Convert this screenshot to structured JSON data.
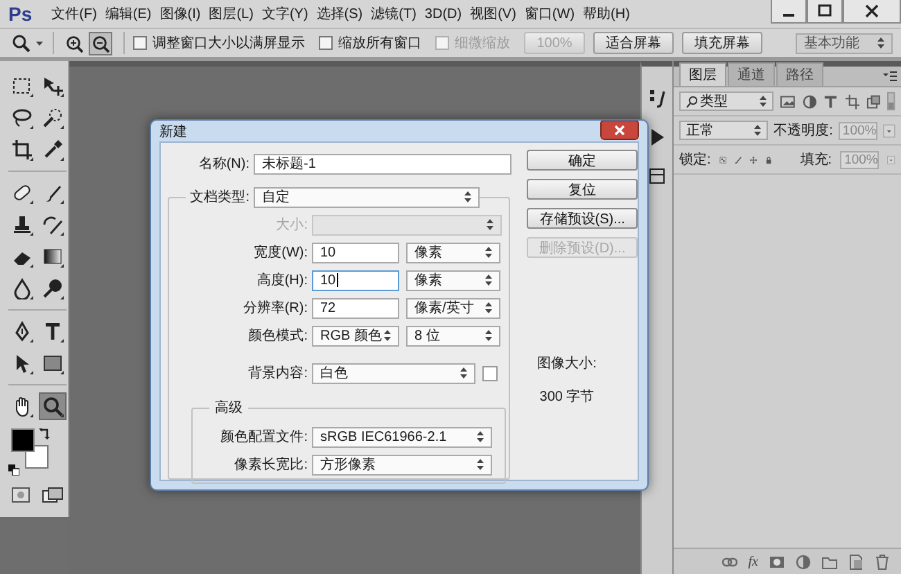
{
  "app": {
    "logo": "Ps",
    "menu": [
      "文件(F)",
      "编辑(E)",
      "图像(I)",
      "图层(L)",
      "文字(Y)",
      "选择(S)",
      "滤镜(T)",
      "3D(D)",
      "视图(V)",
      "窗口(W)",
      "帮助(H)"
    ]
  },
  "options_bar": {
    "zoom_modes": [
      {
        "kind": "zoom-in",
        "selected": false
      },
      {
        "kind": "zoom-out",
        "selected": true
      }
    ],
    "checkboxes": [
      {
        "label": "调整窗口大小以满屏显示",
        "checked": false,
        "disabled": false
      },
      {
        "label": "缩放所有窗口",
        "checked": false,
        "disabled": false
      },
      {
        "label": "细微缩放",
        "checked": false,
        "disabled": true
      }
    ],
    "buttons": [
      {
        "label": "100%",
        "disabled": true
      },
      {
        "label": "适合屏幕",
        "disabled": false
      },
      {
        "label": "填充屏幕",
        "disabled": false
      }
    ],
    "workspace": "基本功能"
  },
  "toolbox": {
    "tools": [
      {
        "kind": "marquee",
        "selected": false
      },
      {
        "kind": "move",
        "selected": false
      },
      {
        "kind": "lasso",
        "selected": false
      },
      {
        "kind": "quick-select",
        "selected": false
      },
      {
        "kind": "crop",
        "selected": false
      },
      {
        "kind": "eyedropper",
        "selected": false
      },
      {
        "kind": "healing",
        "selected": false
      },
      {
        "kind": "brush",
        "selected": false
      },
      {
        "kind": "stamp",
        "selected": false
      },
      {
        "kind": "history-brush",
        "selected": false
      },
      {
        "kind": "eraser",
        "selected": false
      },
      {
        "kind": "gradient",
        "selected": false
      },
      {
        "kind": "blur",
        "selected": false
      },
      {
        "kind": "dodge",
        "selected": false
      },
      {
        "kind": "pen",
        "selected": false
      },
      {
        "kind": "type",
        "selected": false
      },
      {
        "kind": "path-select",
        "selected": false
      },
      {
        "kind": "shape",
        "selected": false
      },
      {
        "kind": "hand",
        "selected": false
      },
      {
        "kind": "zoom",
        "selected": true
      }
    ]
  },
  "dialog": {
    "title": "新建",
    "rows": [
      {
        "kind": "name",
        "label": "名称(N):",
        "disabled": false,
        "controls": [
          {
            "kind": "input",
            "value": "未标题-1",
            "focused": false
          }
        ]
      },
      {
        "kind": "doctype",
        "label": "文档类型:",
        "disabled": false,
        "controls": [
          {
            "kind": "select",
            "value": "自定"
          }
        ]
      },
      {
        "kind": "size",
        "label": "大小:",
        "disabled": true,
        "controls": [
          {
            "kind": "select"
          }
        ]
      },
      {
        "kind": "pair",
        "label": "宽度(W):",
        "disabled": false,
        "controls": [
          {
            "kind": "input",
            "value": "10",
            "focused": false
          },
          {
            "kind": "select",
            "value": "像素"
          }
        ]
      },
      {
        "kind": "pair",
        "label": "高度(H):",
        "disabled": false,
        "controls": [
          {
            "kind": "input",
            "value": "10",
            "focused": true
          },
          {
            "kind": "select",
            "value": "像素"
          }
        ]
      },
      {
        "kind": "pair",
        "label": "分辨率(R):",
        "disabled": false,
        "controls": [
          {
            "kind": "input",
            "value": "72",
            "focused": false
          },
          {
            "kind": "select",
            "value": "像素/英寸"
          }
        ]
      },
      {
        "kind": "pair",
        "label": "颜色模式:",
        "disabled": false,
        "controls": [
          {
            "kind": "select",
            "value": "RGB 颜色"
          },
          {
            "kind": "select",
            "value": "8 位"
          }
        ]
      },
      {
        "kind": "background",
        "label": "背景内容:",
        "disabled": false,
        "controls": [
          {
            "kind": "select",
            "value": "白色"
          }
        ]
      }
    ],
    "advanced": {
      "title": "高级",
      "rows": [
        {
          "kind": "advanced",
          "label": "颜色配置文件:",
          "disabled": false,
          "controls": [
            {
              "kind": "select",
              "value": "sRGB IEC61966-2.1"
            }
          ]
        },
        {
          "kind": "advanced",
          "label": "像素长宽比:",
          "disabled": false,
          "controls": [
            {
              "kind": "select",
              "value": "方形像素"
            }
          ]
        }
      ]
    },
    "buttons": [
      {
        "label": "确定",
        "disabled": false
      },
      {
        "label": "复位",
        "disabled": false
      },
      {
        "label": "存储预设(S)...",
        "disabled": false
      },
      {
        "label": "删除预设(D)...",
        "disabled": true
      }
    ],
    "image_size_label": "图像大小:",
    "image_size": "300 字节"
  },
  "panel": {
    "tabs": [
      {
        "label": "图层",
        "selected": true
      },
      {
        "label": "通道",
        "selected": false
      },
      {
        "label": "路径",
        "selected": false
      }
    ],
    "filter": "类型",
    "blend_mode": "正常",
    "opacity_label": "不透明度:",
    "opacity": "100%",
    "lock_label": "锁定:",
    "fill_label": "填充:",
    "fill": "100%",
    "footer_text": "fx"
  }
}
